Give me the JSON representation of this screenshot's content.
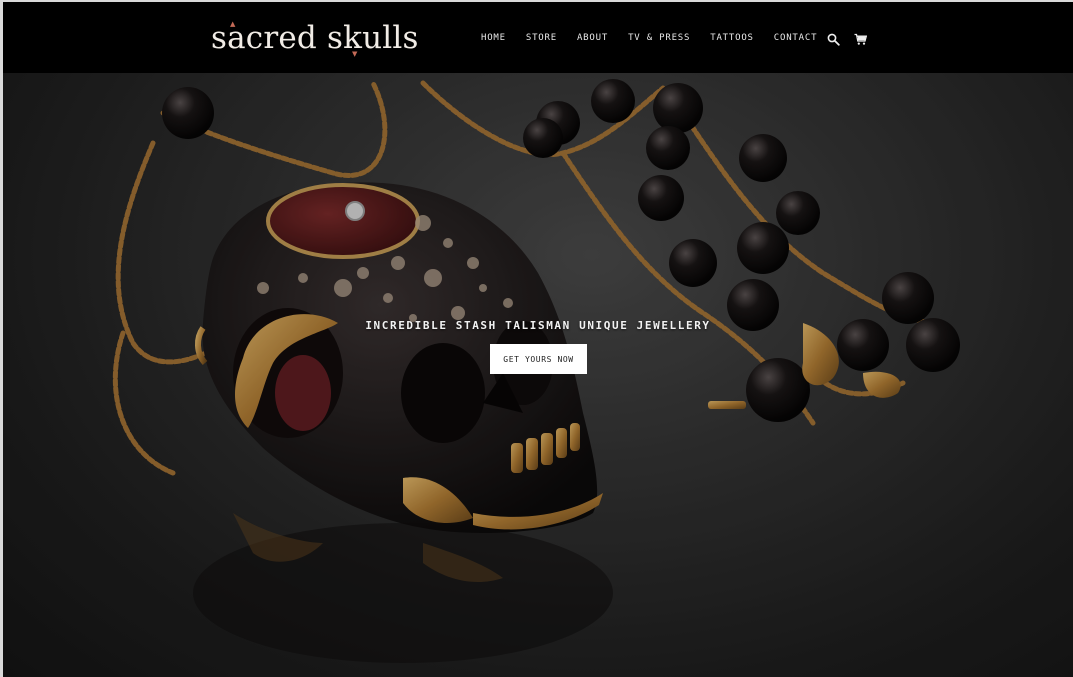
{
  "header": {
    "logo_text": "sacred skulls",
    "nav": [
      {
        "label": "HOME"
      },
      {
        "label": "STORE"
      },
      {
        "label": "ABOUT"
      },
      {
        "label": "TV & PRESS"
      },
      {
        "label": "TATTOOS"
      },
      {
        "label": "CONTACT"
      }
    ],
    "icons": [
      "search-icon",
      "cart-icon"
    ]
  },
  "hero": {
    "headline": "INCREDIBLE STASH TALISMAN UNIQUE JEWELLERY",
    "cta_label": "GET YOURS NOW",
    "image_subject": "carved skull pendant with gold chain and black beads"
  },
  "colors": {
    "header_bg": "#000000",
    "logo": "#f1ece6",
    "logo_accent": "#c46a57",
    "nav_text": "#e8e8e8",
    "cta_bg": "#ffffff",
    "cta_text": "#222222"
  }
}
